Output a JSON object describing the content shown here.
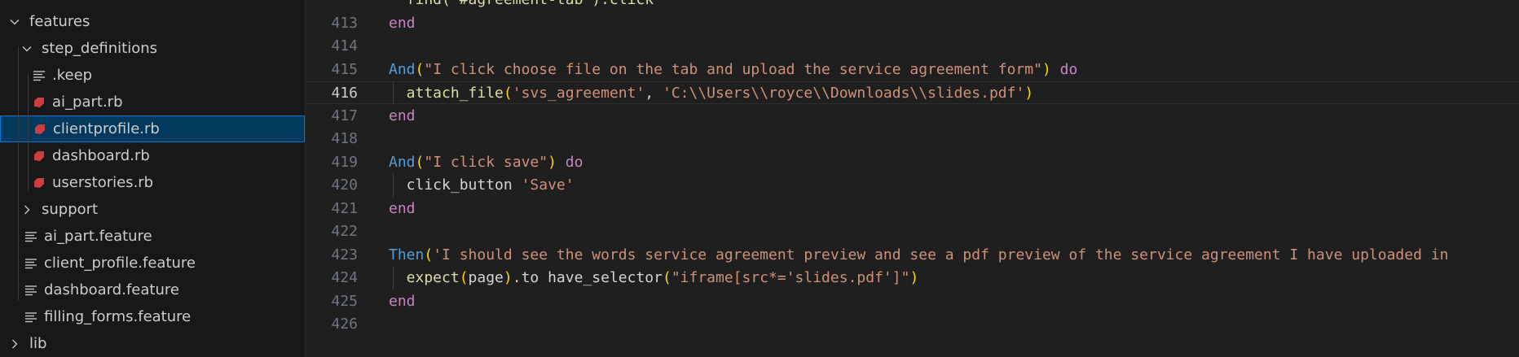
{
  "explorer": {
    "items": [
      {
        "label": "features",
        "kind": "folder-open",
        "indent": 0
      },
      {
        "label": "step_definitions",
        "kind": "folder-open",
        "indent": 1
      },
      {
        "label": ".keep",
        "kind": "text-file",
        "indent": 2
      },
      {
        "label": "ai_part.rb",
        "kind": "ruby-file",
        "indent": 2
      },
      {
        "label": "clientprofile.rb",
        "kind": "ruby-file",
        "indent": 2,
        "selected": true
      },
      {
        "label": "dashboard.rb",
        "kind": "ruby-file",
        "indent": 2
      },
      {
        "label": "userstories.rb",
        "kind": "ruby-file",
        "indent": 2
      },
      {
        "label": "support",
        "kind": "folder-closed",
        "indent": 1
      },
      {
        "label": "ai_part.feature",
        "kind": "text-file",
        "indent": 1
      },
      {
        "label": "client_profile.feature",
        "kind": "text-file",
        "indent": 1
      },
      {
        "label": "dashboard.feature",
        "kind": "text-file",
        "indent": 1
      },
      {
        "label": "filling_forms.feature",
        "kind": "text-file",
        "indent": 1
      },
      {
        "label": "lib",
        "kind": "folder-closed",
        "indent": 0
      }
    ]
  },
  "editor": {
    "active_line": "416",
    "lines": [
      {
        "n": "",
        "tokens": [
          {
            "t": "  find(\"#agreement-tab\").click",
            "c": "fn"
          }
        ]
      },
      {
        "n": "413",
        "tokens": [
          {
            "t": "end",
            "c": "kw-purple"
          }
        ]
      },
      {
        "n": "414",
        "tokens": []
      },
      {
        "n": "415",
        "tokens": [
          {
            "t": "And",
            "c": "kw-blue"
          },
          {
            "t": "(",
            "c": "paren-y"
          },
          {
            "t": "\"I click choose file on the tab and upload the service agreement form\"",
            "c": "str"
          },
          {
            "t": ")",
            "c": "paren-y"
          },
          {
            "t": " do",
            "c": "kw-purple"
          }
        ]
      },
      {
        "n": "416",
        "indent": true,
        "tokens": [
          {
            "t": "  attach_file",
            "c": "fn"
          },
          {
            "t": "(",
            "c": "paren-y"
          },
          {
            "t": "'svs_agreement'",
            "c": "str"
          },
          {
            "t": ", ",
            "c": "plain"
          },
          {
            "t": "'C:\\\\Users\\\\royce\\\\Downloads\\\\slides.pdf'",
            "c": "str"
          },
          {
            "t": ")",
            "c": "paren-y"
          }
        ]
      },
      {
        "n": "417",
        "tokens": [
          {
            "t": "end",
            "c": "kw-purple"
          }
        ]
      },
      {
        "n": "418",
        "tokens": []
      },
      {
        "n": "419",
        "tokens": [
          {
            "t": "And",
            "c": "kw-blue"
          },
          {
            "t": "(",
            "c": "paren-y"
          },
          {
            "t": "\"I click save\"",
            "c": "str"
          },
          {
            "t": ")",
            "c": "paren-y"
          },
          {
            "t": " do",
            "c": "kw-purple"
          }
        ]
      },
      {
        "n": "420",
        "indent": true,
        "tokens": [
          {
            "t": "  click_button ",
            "c": "plain"
          },
          {
            "t": "'Save'",
            "c": "str"
          }
        ]
      },
      {
        "n": "421",
        "tokens": [
          {
            "t": "end",
            "c": "kw-purple"
          }
        ]
      },
      {
        "n": "422",
        "tokens": []
      },
      {
        "n": "423",
        "tokens": [
          {
            "t": "Then",
            "c": "kw-blue"
          },
          {
            "t": "(",
            "c": "paren-y"
          },
          {
            "t": "'I should see the words service agreement preview and see a pdf preview of the service agreement I have uploaded in",
            "c": "str"
          }
        ]
      },
      {
        "n": "424",
        "indent": true,
        "tokens": [
          {
            "t": "  expect",
            "c": "fn"
          },
          {
            "t": "(",
            "c": "paren-y"
          },
          {
            "t": "page",
            "c": "plain"
          },
          {
            "t": ")",
            "c": "paren-y"
          },
          {
            "t": ".to have_selector",
            "c": "plain"
          },
          {
            "t": "(",
            "c": "paren-y"
          },
          {
            "t": "\"iframe[src*='slides.pdf']\"",
            "c": "str"
          },
          {
            "t": ")",
            "c": "paren-y"
          }
        ]
      },
      {
        "n": "425",
        "tokens": [
          {
            "t": "end",
            "c": "kw-purple"
          }
        ]
      },
      {
        "n": "426",
        "tokens": []
      }
    ]
  }
}
